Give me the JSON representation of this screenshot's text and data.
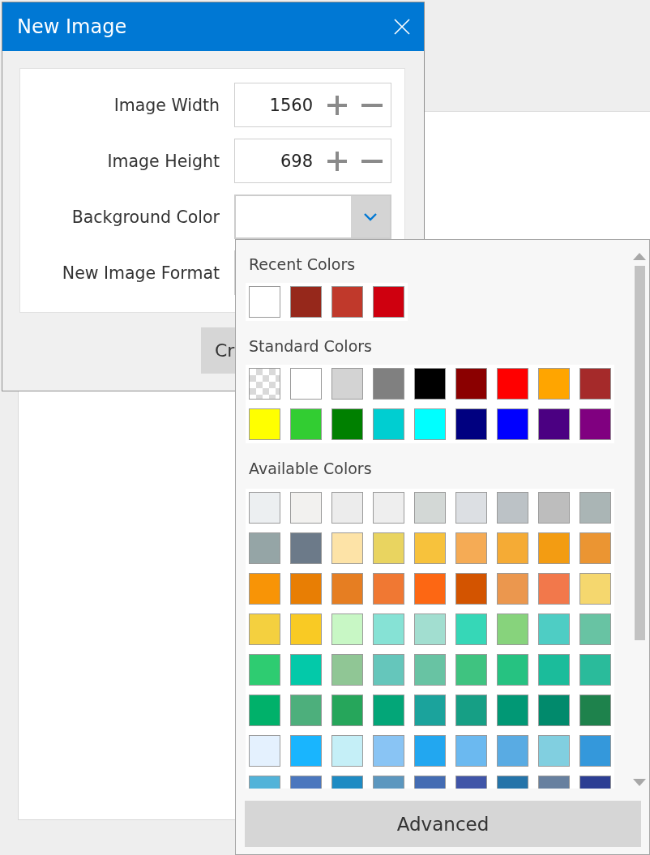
{
  "dialog": {
    "title": "New Image",
    "fields": [
      {
        "kind": "number",
        "label": "Image Width",
        "value": "1560"
      },
      {
        "kind": "number",
        "label": "Image Height",
        "value": "698"
      },
      {
        "kind": "color",
        "label": "Background Color",
        "color": "#ffffff"
      },
      {
        "kind": "select",
        "label": "New Image Format"
      }
    ],
    "button": "Cr"
  },
  "color_popup": {
    "sections": [
      {
        "title": "Recent Colors",
        "swatches": [
          {
            "color": "#ffffff"
          },
          {
            "color": "#96281b"
          },
          {
            "color": "#c0392b"
          },
          {
            "color": "#cf000f"
          }
        ]
      },
      {
        "title": "Standard Colors",
        "swatches": [
          {
            "kind": "transparent"
          },
          {
            "kind": "solid",
            "color": "#ffffff"
          },
          {
            "kind": "solid",
            "color": "#d3d3d3"
          },
          {
            "kind": "solid",
            "color": "#808080"
          },
          {
            "kind": "solid",
            "color": "#000000"
          },
          {
            "kind": "solid",
            "color": "#8b0000"
          },
          {
            "kind": "solid",
            "color": "#ff0000"
          },
          {
            "kind": "solid",
            "color": "#ffa500"
          },
          {
            "kind": "solid",
            "color": "#a52a2a"
          },
          {
            "kind": "solid",
            "color": "#ffff00"
          },
          {
            "kind": "solid",
            "color": "#32cd32"
          },
          {
            "kind": "solid",
            "color": "#008000"
          },
          {
            "kind": "solid",
            "color": "#00ced1"
          },
          {
            "kind": "solid",
            "color": "#00ffff"
          },
          {
            "kind": "solid",
            "color": "#000080"
          },
          {
            "kind": "solid",
            "color": "#0000ff"
          },
          {
            "kind": "solid",
            "color": "#4b0082"
          },
          {
            "kind": "solid",
            "color": "#800080"
          }
        ]
      },
      {
        "title": "Available Colors",
        "swatches": [
          {
            "color": "#eceff1"
          },
          {
            "color": "#f2f1ef"
          },
          {
            "color": "#ececec"
          },
          {
            "color": "#eeeeee"
          },
          {
            "color": "#d3d8d6"
          },
          {
            "color": "#dcdfe3"
          },
          {
            "color": "#bcc2c6"
          },
          {
            "color": "#bdbdbd"
          },
          {
            "color": "#aab5b5"
          },
          {
            "color": "#95a5a6"
          },
          {
            "color": "#6c7a89"
          },
          {
            "color": "#fde3a7"
          },
          {
            "color": "#e9d460"
          },
          {
            "color": "#f7c23c"
          },
          {
            "color": "#f5ab55"
          },
          {
            "color": "#f5ab35"
          },
          {
            "color": "#f39c12"
          },
          {
            "color": "#eb9532"
          },
          {
            "color": "#f89406"
          },
          {
            "color": "#e87e04"
          },
          {
            "color": "#e67e22"
          },
          {
            "color": "#f07833"
          },
          {
            "color": "#fd6713"
          },
          {
            "color": "#d35400"
          },
          {
            "color": "#eb974e"
          },
          {
            "color": "#f2784b"
          },
          {
            "color": "#f5d76e"
          },
          {
            "color": "#f4d03f"
          },
          {
            "color": "#f9ca24"
          },
          {
            "color": "#c8f7c5"
          },
          {
            "color": "#86e2d5"
          },
          {
            "color": "#a2ded0"
          },
          {
            "color": "#36d7b7"
          },
          {
            "color": "#87d37c"
          },
          {
            "color": "#4ecdc4"
          },
          {
            "color": "#68c3a3"
          },
          {
            "color": "#2ecc71"
          },
          {
            "color": "#03c9a9"
          },
          {
            "color": "#90c695"
          },
          {
            "color": "#65c6bb"
          },
          {
            "color": "#68c3a3"
          },
          {
            "color": "#3fc380"
          },
          {
            "color": "#26c281"
          },
          {
            "color": "#1bbc9b"
          },
          {
            "color": "#2abb9b"
          },
          {
            "color": "#00b16a"
          },
          {
            "color": "#4daf7c"
          },
          {
            "color": "#26a65b"
          },
          {
            "color": "#03a678"
          },
          {
            "color": "#1ba39c"
          },
          {
            "color": "#169f85"
          },
          {
            "color": "#019875"
          },
          {
            "color": "#018a6c"
          },
          {
            "color": "#1e824c"
          },
          {
            "color": "#e4f1fe"
          },
          {
            "color": "#19b5fe"
          },
          {
            "color": "#c5eff7"
          },
          {
            "color": "#89c4f4"
          },
          {
            "color": "#22a7f0"
          },
          {
            "color": "#6bb9f0"
          },
          {
            "color": "#59abe3"
          },
          {
            "color": "#81cfe0"
          },
          {
            "color": "#3498db"
          },
          {
            "color": "#52b3d9"
          },
          {
            "color": "#4b77be"
          },
          {
            "color": "#1e8bc3"
          },
          {
            "color": "#5c97bf"
          },
          {
            "color": "#446cb3"
          },
          {
            "color": "#4055a8"
          },
          {
            "color": "#2574a9"
          },
          {
            "color": "#67809f"
          },
          {
            "color": "#2c3e93"
          }
        ]
      }
    ],
    "button": "Advanced"
  }
}
